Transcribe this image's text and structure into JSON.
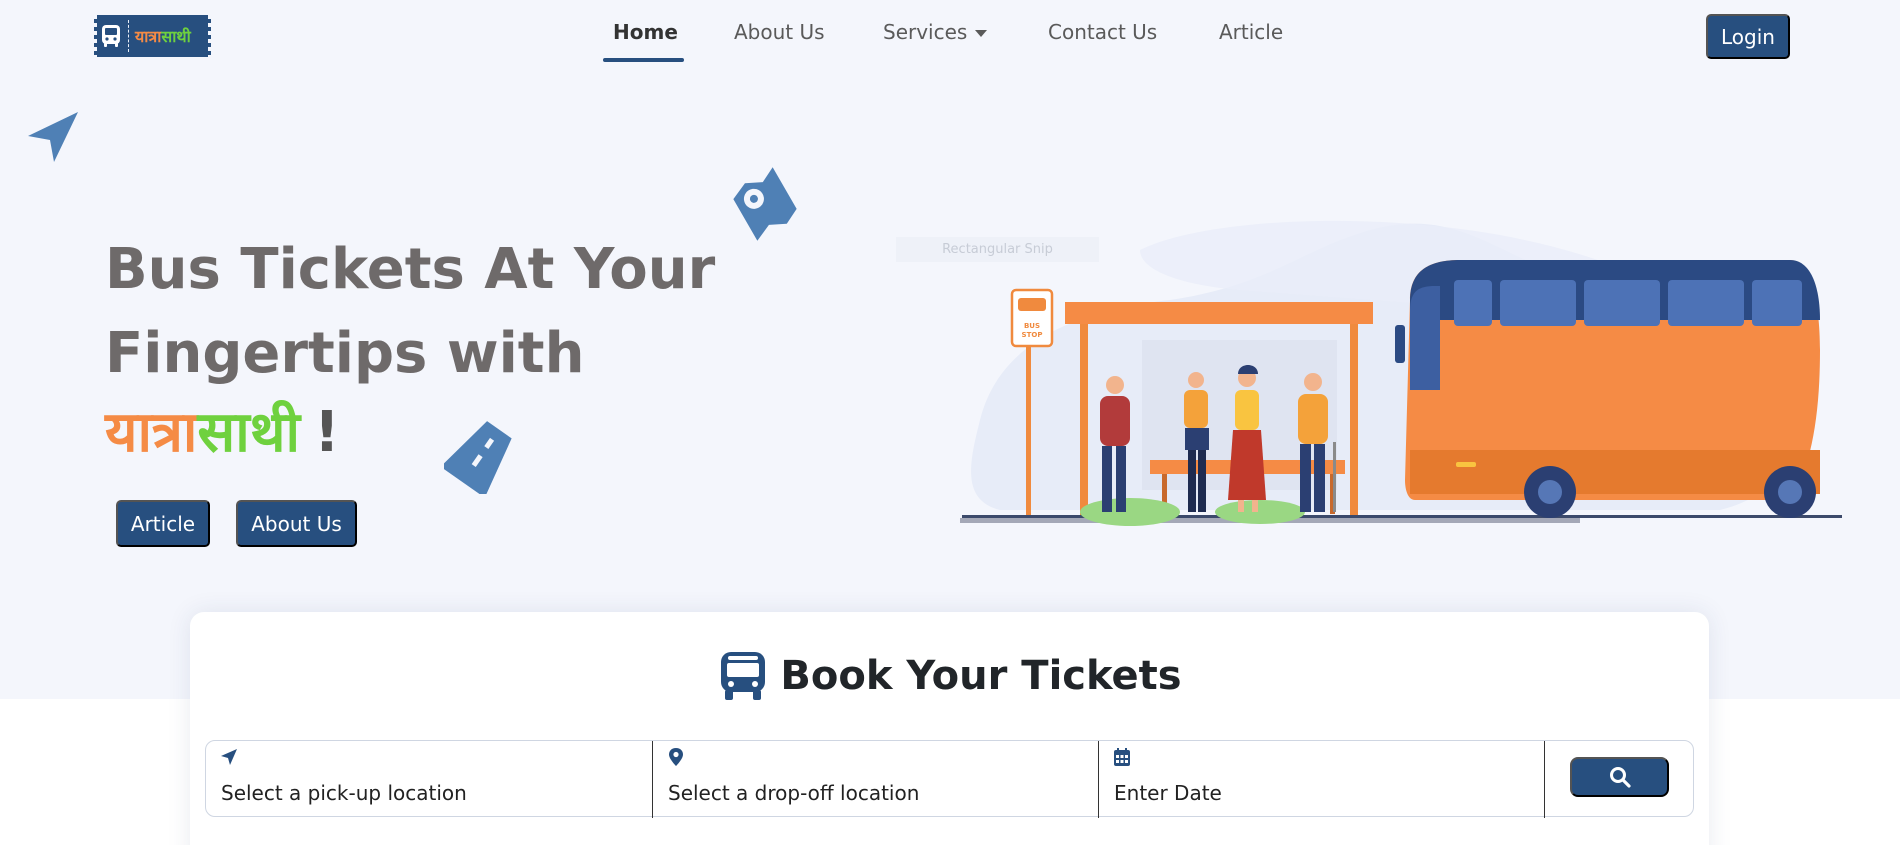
{
  "colors": {
    "primary": "#274f7f",
    "hero_background": "#f4f6fc",
    "brand_orange": "#f58b45",
    "brand_green": "#6fd13e",
    "heading_gray": "#6e6a6a"
  },
  "logo": {
    "icon": "bus-icon",
    "text_part1": "यात्रा",
    "text_part2": "साथी"
  },
  "nav": {
    "items": [
      {
        "label": "Home",
        "active": true
      },
      {
        "label": "About Us",
        "active": false
      },
      {
        "label": "Services",
        "active": false,
        "dropdown": true
      },
      {
        "label": "Contact Us",
        "active": false
      },
      {
        "label": "Article",
        "active": false
      }
    ],
    "login_label": "Login"
  },
  "hero": {
    "title": "Bus Tickets At Your Fingertips with",
    "brand_part1": "यात्रा",
    "brand_part2": "साथी",
    "brand_suffix": "!",
    "buttons": [
      "Article",
      "About Us"
    ],
    "snip_label": "Rectangular Snip",
    "illustration": {
      "icon": "bus-stop-illustration",
      "sign_text": "BUS STOP"
    }
  },
  "booking": {
    "title_icon": "bus-icon",
    "title": "Book Your Tickets",
    "fields": [
      {
        "icon": "location-arrow-icon",
        "text": "Select a pick-up location"
      },
      {
        "icon": "map-pin-icon",
        "text": "Select a drop-off location"
      },
      {
        "icon": "calendar-icon",
        "text": "Enter Date"
      }
    ],
    "search_icon": "search-icon"
  }
}
